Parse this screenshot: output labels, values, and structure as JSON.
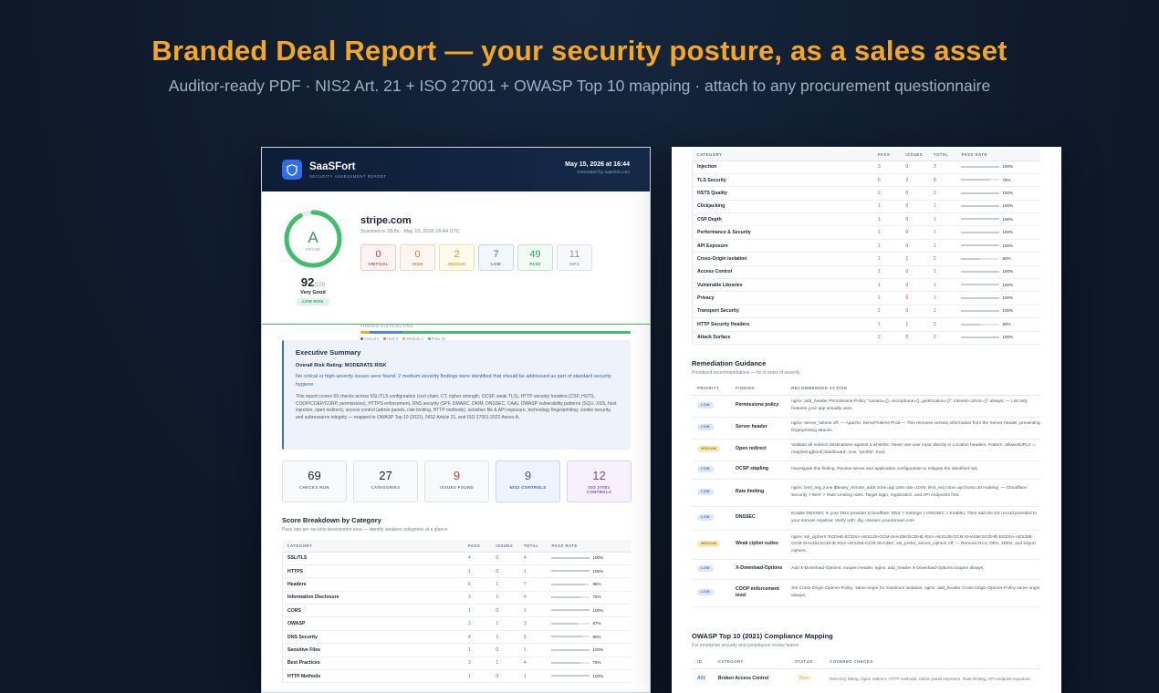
{
  "hero": {
    "title": "Branded Deal Report — your security posture, as a sales asset",
    "subtitle": "Auditor-ready PDF  ·  NIS2 Art. 21 + ISO 27001 + OWASP Top 10 mapping  ·  attach to any procurement questionnaire"
  },
  "report": {
    "brand": "SaaSFort",
    "brand_tagline": "SECURITY ASSESSMENT REPORT",
    "date": "May 15, 2026 at 16:44",
    "generated_by": "Generated by saasfort.com",
    "grade": "A",
    "grade_label": "GRADE",
    "score": "92",
    "score_max": "/100",
    "score_word": "Very Good",
    "risk_badge": "LOW RISK",
    "domain": "stripe.com",
    "scanned": "Scanned in 28.8s · May 15, 2026 16:44 UTC",
    "counts": [
      {
        "n": "0",
        "label": "CRITICAL",
        "color": "#d83a3a",
        "border": "#f3c4c4",
        "bg": "#fdf3f3"
      },
      {
        "n": "0",
        "label": "HIGH",
        "color": "#e0772a",
        "border": "#f6d3b6",
        "bg": "#fef7f1"
      },
      {
        "n": "2",
        "label": "MEDIUM",
        "color": "#d9a514",
        "border": "#f2df9e",
        "bg": "#fefaee"
      },
      {
        "n": "7",
        "label": "LOW",
        "color": "#3b6fd6",
        "border": "#c4d6f5",
        "bg": "#f2f6fe"
      },
      {
        "n": "49",
        "label": "PASS",
        "color": "#2ea05a",
        "border": "#bfe6cd",
        "bg": "#f2fbf5"
      },
      {
        "n": "11",
        "label": "INFO",
        "color": "#8b95a5",
        "border": "#dde1e7",
        "bg": "#f8f9fb"
      }
    ],
    "dist_caption": "FINDING DISTRIBUTION",
    "distribution": [
      {
        "label": "Critical 0",
        "value": 0,
        "color": "#d83a3a"
      },
      {
        "label": "High 0",
        "value": 0,
        "color": "#e0772a"
      },
      {
        "label": "Medium 2",
        "value": 2,
        "color": "#e6b422"
      },
      {
        "label": "Pass 49",
        "value": 49,
        "color": "#3fbf6a"
      }
    ],
    "dist_low_value": 7,
    "dist_low_color": "#4a86e8",
    "summary": {
      "title": "Executive Summary",
      "risk_rating": "Overall Risk Rating: MODERATE RISK",
      "p1": "No critical or high-severity issues were found. 2 medium-severity findings were identified that should be addressed as part of standard security hygiene.",
      "p2": "This report covers 69 checks across SSL/TLS configuration (cert chain, CT, cipher strength, OCSP, weak TLS), HTTP security headers (CSP, HSTS, COOP/COEP/CORP, permissions), HTTPS enforcement, DNS security (SPF, DMARC, DKIM, DNSSEC, CAA), OWASP vulnerability patterns (SQLi, XSS, host injection, open redirect), access control (admin panels, rate limiting, HTTP methods), sensitive file & API exposure, technology fingerprinting, cookie security, and subresource integrity — mapped to OWASP Top 10 (2021), NIS2 Article 21, and ISO 27001:2022 Annex A."
    },
    "stats": [
      {
        "n": "69",
        "label": "CHECKS RUN",
        "color": "#1a2333",
        "border": "#dde2ea",
        "bg": "#f8f9fb",
        "lcolor": "#6b7585"
      },
      {
        "n": "27",
        "label": "CATEGORIES",
        "color": "#1a2333",
        "border": "#dde2ea",
        "bg": "#f8f9fb",
        "lcolor": "#6b7585"
      },
      {
        "n": "9",
        "label": "ISSUES FOUND",
        "color": "#d83a3a",
        "border": "#dde2ea",
        "bg": "#f8f9fb",
        "lcolor": "#6b7585"
      },
      {
        "n": "9",
        "label": "NIS2 CONTROLS",
        "color": "#2f5fb5",
        "border": "#c4d6f5",
        "bg": "#eef3fd",
        "lcolor": "#2f5fb5"
      },
      {
        "n": "12",
        "label": "ISO 27001 CONTROLS",
        "color": "#7b3fc7",
        "border": "#e0cff5",
        "bg": "#f7f1fd",
        "lcolor": "#7b3fc7"
      }
    ],
    "breakdown": {
      "title": "Score Breakdown by Category",
      "subtitle": "Pass rate per security assessment area — identify weakest categories at a glance",
      "headers": [
        "CATEGORY",
        "PASS",
        "ISSUES",
        "TOTAL",
        "PASS RATE"
      ],
      "rows": [
        {
          "name": "SSL/TLS",
          "pass": "4",
          "issues": "0",
          "total": "4",
          "rate": "100%",
          "pct": 100
        },
        {
          "name": "HTTPS",
          "pass": "1",
          "issues": "0",
          "total": "1",
          "rate": "100%",
          "pct": 100
        },
        {
          "name": "Headers",
          "pass": "6",
          "issues": "1",
          "total": "7",
          "rate": "86%",
          "pct": 86
        },
        {
          "name": "Information Disclosure",
          "pass": "3",
          "issues": "1",
          "total": "4",
          "rate": "75%",
          "pct": 75
        },
        {
          "name": "CORS",
          "pass": "1",
          "issues": "0",
          "total": "1",
          "rate": "100%",
          "pct": 100
        },
        {
          "name": "OWASP",
          "pass": "2",
          "issues": "1",
          "total": "3",
          "rate": "67%",
          "pct": 67
        },
        {
          "name": "DNS Security",
          "pass": "4",
          "issues": "1",
          "total": "5",
          "rate": "80%",
          "pct": 80
        },
        {
          "name": "Sensitive Files",
          "pass": "1",
          "issues": "0",
          "total": "1",
          "rate": "100%",
          "pct": 100
        },
        {
          "name": "Best Practices",
          "pass": "3",
          "issues": "1",
          "total": "4",
          "rate": "75%",
          "pct": 75
        },
        {
          "name": "HTTP Methods",
          "pass": "1",
          "issues": "0",
          "total": "1",
          "rate": "100%",
          "pct": 100
        }
      ]
    }
  },
  "page2": {
    "headers": [
      "CATEGORY",
      "PASS",
      "ISSUES",
      "TOTAL",
      "PASS RATE"
    ],
    "rows": [
      {
        "name": "Injection",
        "pass": "3",
        "issues": "0",
        "total": "3",
        "rate": "100%",
        "pct": 100
      },
      {
        "name": "TLS Security",
        "pass": "6",
        "issues": "2",
        "total": "8",
        "rate": "75%",
        "pct": 75
      },
      {
        "name": "HSTS Quality",
        "pass": "2",
        "issues": "0",
        "total": "2",
        "rate": "100%",
        "pct": 100
      },
      {
        "name": "Clickjacking",
        "pass": "1",
        "issues": "0",
        "total": "1",
        "rate": "100%",
        "pct": 100
      },
      {
        "name": "CSP Depth",
        "pass": "1",
        "issues": "0",
        "total": "1",
        "rate": "100%",
        "pct": 100
      },
      {
        "name": "Performance & Security",
        "pass": "1",
        "issues": "0",
        "total": "1",
        "rate": "100%",
        "pct": 100
      },
      {
        "name": "API Exposure",
        "pass": "1",
        "issues": "0",
        "total": "1",
        "rate": "100%",
        "pct": 100
      },
      {
        "name": "Cross-Origin Isolation",
        "pass": "1",
        "issues": "1",
        "total": "2",
        "rate": "50%",
        "pct": 50
      },
      {
        "name": "Access Control",
        "pass": "1",
        "issues": "0",
        "total": "1",
        "rate": "100%",
        "pct": 100
      },
      {
        "name": "Vulnerable Libraries",
        "pass": "1",
        "issues": "0",
        "total": "1",
        "rate": "100%",
        "pct": 100
      },
      {
        "name": "Privacy",
        "pass": "1",
        "issues": "0",
        "total": "1",
        "rate": "100%",
        "pct": 100
      },
      {
        "name": "Transport Security",
        "pass": "1",
        "issues": "0",
        "total": "1",
        "rate": "100%",
        "pct": 100
      },
      {
        "name": "HTTP Security Headers",
        "pass": "1",
        "issues": "1",
        "total": "2",
        "rate": "50%",
        "pct": 50
      },
      {
        "name": "Attack Surface",
        "pass": "2",
        "issues": "0",
        "total": "2",
        "rate": "100%",
        "pct": 100
      }
    ],
    "remediation": {
      "title": "Remediation Guidance",
      "subtitle": "Prioritized recommendations — fix in order of severity",
      "headers": [
        "PRIORITY",
        "FINDING",
        "RECOMMENDED ACTION"
      ],
      "rows": [
        {
          "prio": "LOW",
          "level": "low",
          "finding": "Permissions policy",
          "action": "nginx: add_header Permissions-Policy \"camera=(), microphone=(), geolocation=()\", interest-cohort=()\" always; — List only features your app actually uses."
        },
        {
          "prio": "LOW",
          "level": "low",
          "finding": "Server header",
          "action": "nginx: server_tokens off; — Apache: ServerTokens Prod — This removes version information from the Server header, preventing fingerprinting attacks."
        },
        {
          "prio": "MEDIUM",
          "level": "med",
          "finding": "Open redirect",
          "action": "Validate all redirect destinations against a whitelist. Never use user input directly in Location headers. Pattern: allowedURLs := map[string]bool{'/dashboard': true, '/profile': true}"
        },
        {
          "prio": "LOW",
          "level": "low",
          "finding": "OCSP stapling",
          "action": "Investigate this finding. Review server and application configuration to mitigate the identified risk."
        },
        {
          "prio": "LOW",
          "level": "low",
          "finding": "Rate limiting",
          "action": "nginx: limit_req_zone $binary_remote_addr zone=api:10m rate=10r/s; limit_req zone=api burst=20 nodelay; — Cloudflare: Security > WAF > Rate Limiting rules. Target login, registration, and API endpoints first."
        },
        {
          "prio": "LOW",
          "level": "low",
          "finding": "DNSSEC",
          "action": "Enable DNSSEC in your DNS provider (Cloudflare: DNS > Settings > DNSSEC > Enable). Then add the DS record provided to your domain registrar. Verify with: dig +dnssec yourdomain.com"
        },
        {
          "prio": "MEDIUM",
          "level": "med",
          "finding": "Weak cipher suites",
          "action": "nginx: ssl_ciphers 'ECDHE-ECDSA-AES128-GCM-SHA256:ECDHE-RSA-AES128-GCM-SHA256:ECDHE-ECDSA-AES256-GCM-SHA384:ECDHE-RSA-AES256-GCM-SHA384'; ssl_prefer_server_ciphers off; — Remove RC4, DES, 3DES, and export ciphers."
        },
        {
          "prio": "LOW",
          "level": "low",
          "finding": "X-Download-Options",
          "action": "Add X-Download-Options: noopen header. nginx: add_header X-Download-Options noopen always;"
        },
        {
          "prio": "LOW",
          "level": "low",
          "finding": "COOP enforcement level",
          "action": "Set Cross-Origin-Opener-Policy: same-origin for maximum isolation. nginx: add_header Cross-Origin-Opener-Policy same-origin always;"
        }
      ]
    },
    "owasp": {
      "title": "OWASP Top 10 (2021) Compliance Mapping",
      "subtitle": "For enterprise security and compliance review teams",
      "headers": [
        "ID",
        "CATEGORY",
        "STATUS",
        "COVERED CHECKS"
      ],
      "rows": [
        {
          "id": "A01",
          "category": "Broken Access Control",
          "status": "◌ Warn",
          "checks": "Directory listing, Open redirect, HTTP methods, Admin panel exposure, Rate limiting, API endpoint exposure"
        }
      ]
    }
  }
}
